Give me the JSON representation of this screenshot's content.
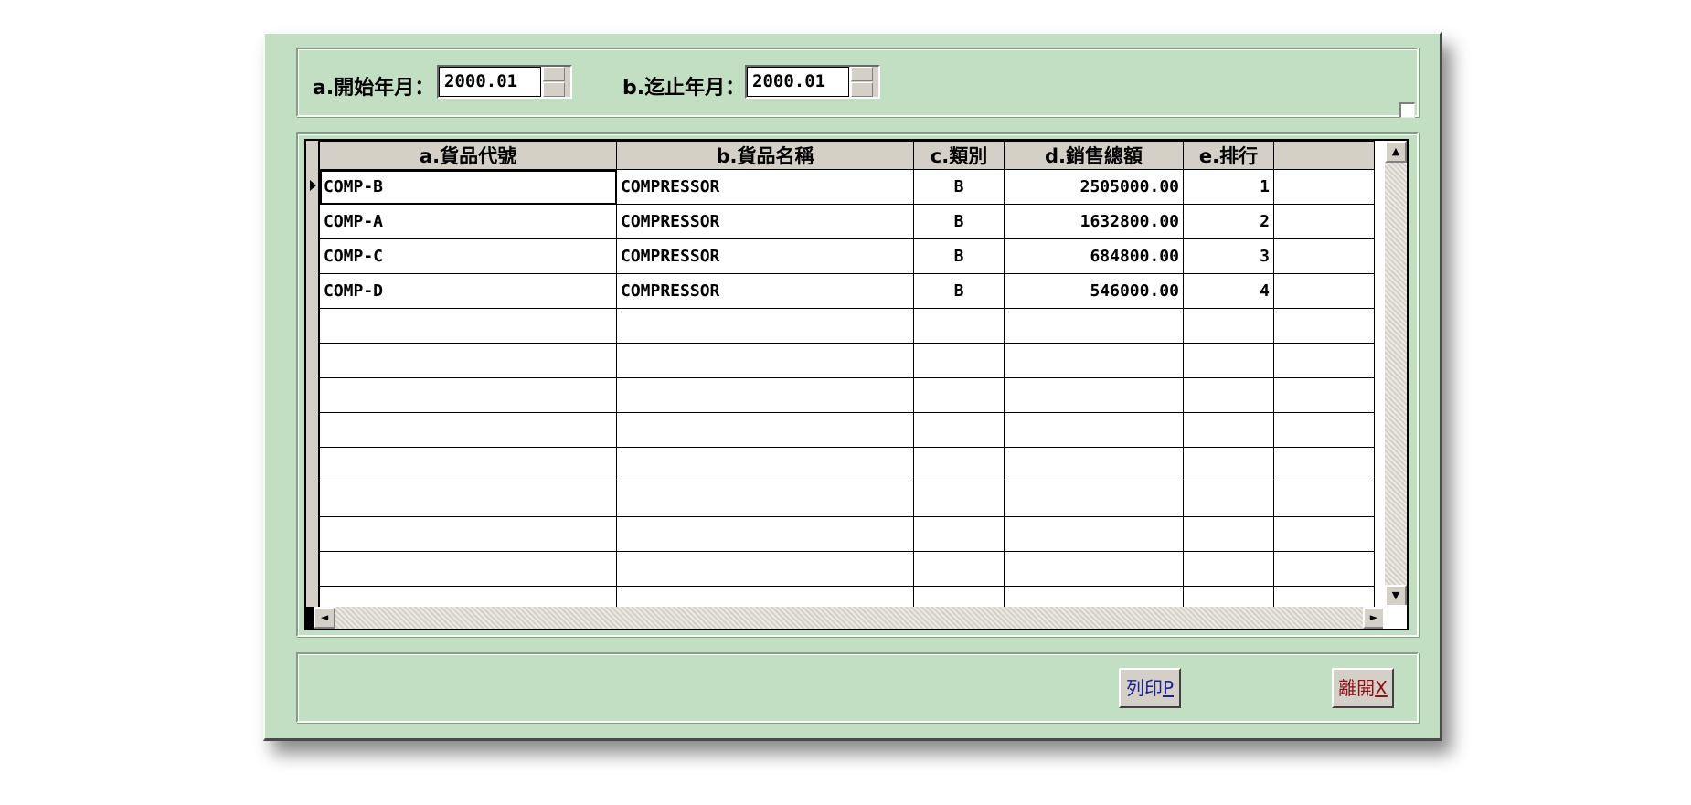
{
  "filters": {
    "start_label": "a.開始年月：",
    "start_value": "2000.01",
    "end_label": "b.迄止年月：",
    "end_value": "2000.01"
  },
  "grid": {
    "columns": [
      "a.貨品代號",
      "b.貨品名稱",
      "c.類別",
      "d.銷售總額",
      "e.排行",
      ""
    ],
    "rows": [
      {
        "code": "COMP-B",
        "name": "COMPRESSOR",
        "category": "B",
        "total": "2505000.00",
        "rank": "1"
      },
      {
        "code": "COMP-A",
        "name": "COMPRESSOR",
        "category": "B",
        "total": "1632800.00",
        "rank": "2"
      },
      {
        "code": "COMP-C",
        "name": "COMPRESSOR",
        "category": "B",
        "total": "684800.00",
        "rank": "3"
      },
      {
        "code": "COMP-D",
        "name": "COMPRESSOR",
        "category": "B",
        "total": "546000.00",
        "rank": "4"
      }
    ],
    "empty_rows": 9
  },
  "buttons": {
    "print_label": "列印",
    "print_hotkey": "P",
    "exit_label": "離開",
    "exit_hotkey": "X"
  },
  "colors": {
    "window_bg": "#c3dfc3",
    "print_text": "#1a2390",
    "exit_text": "#8c0f18"
  }
}
